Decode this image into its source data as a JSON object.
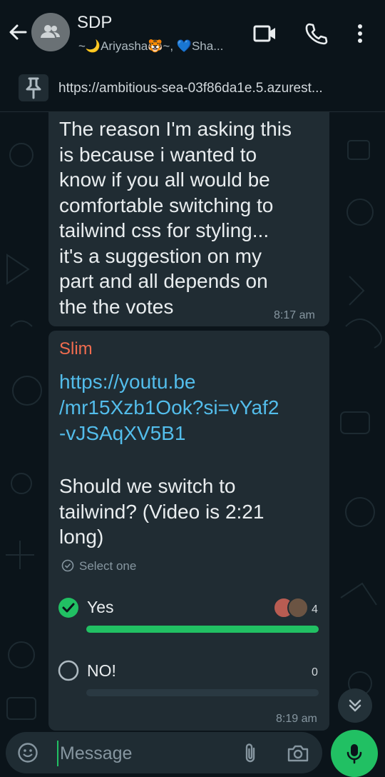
{
  "header": {
    "title": "SDP",
    "subtitle": "~🌙Ariyasha🐯~, 💙Sha..."
  },
  "pinned": {
    "url": "https://ambitious-sea-03f86da1e.5.azurest..."
  },
  "messages": [
    {
      "text_lines": [
        "The reason I'm asking this",
        "is because i wanted to",
        "know if you all would be",
        "comfortable switching to",
        "tailwind css for styling...",
        "it's a suggestion on my",
        "part and all depends on",
        "the the votes"
      ],
      "time": "8:17 am"
    },
    {
      "sender": "Slim",
      "link_lines": [
        "https://youtu.be",
        "/mr15Xzb1Ook?si=vYaf2",
        "-vJSAqXV5B1"
      ],
      "poll": {
        "question_lines": [
          "Should we switch to",
          "tailwind? (Video is 2:21",
          "long)"
        ],
        "select_label": "Select one",
        "options": [
          {
            "label": "Yes",
            "votes": "4",
            "fraction": 1.0,
            "selected": true
          },
          {
            "label": "NO!",
            "votes": "0",
            "fraction": 0.0,
            "selected": false
          }
        ]
      },
      "time": "8:19 am"
    }
  ],
  "input": {
    "placeholder": "Message"
  },
  "colors": {
    "accent": "#21c063",
    "link": "#53bdeb",
    "sender": "#f16c4f",
    "bubble": "#202c33",
    "background": "#0b141a"
  }
}
